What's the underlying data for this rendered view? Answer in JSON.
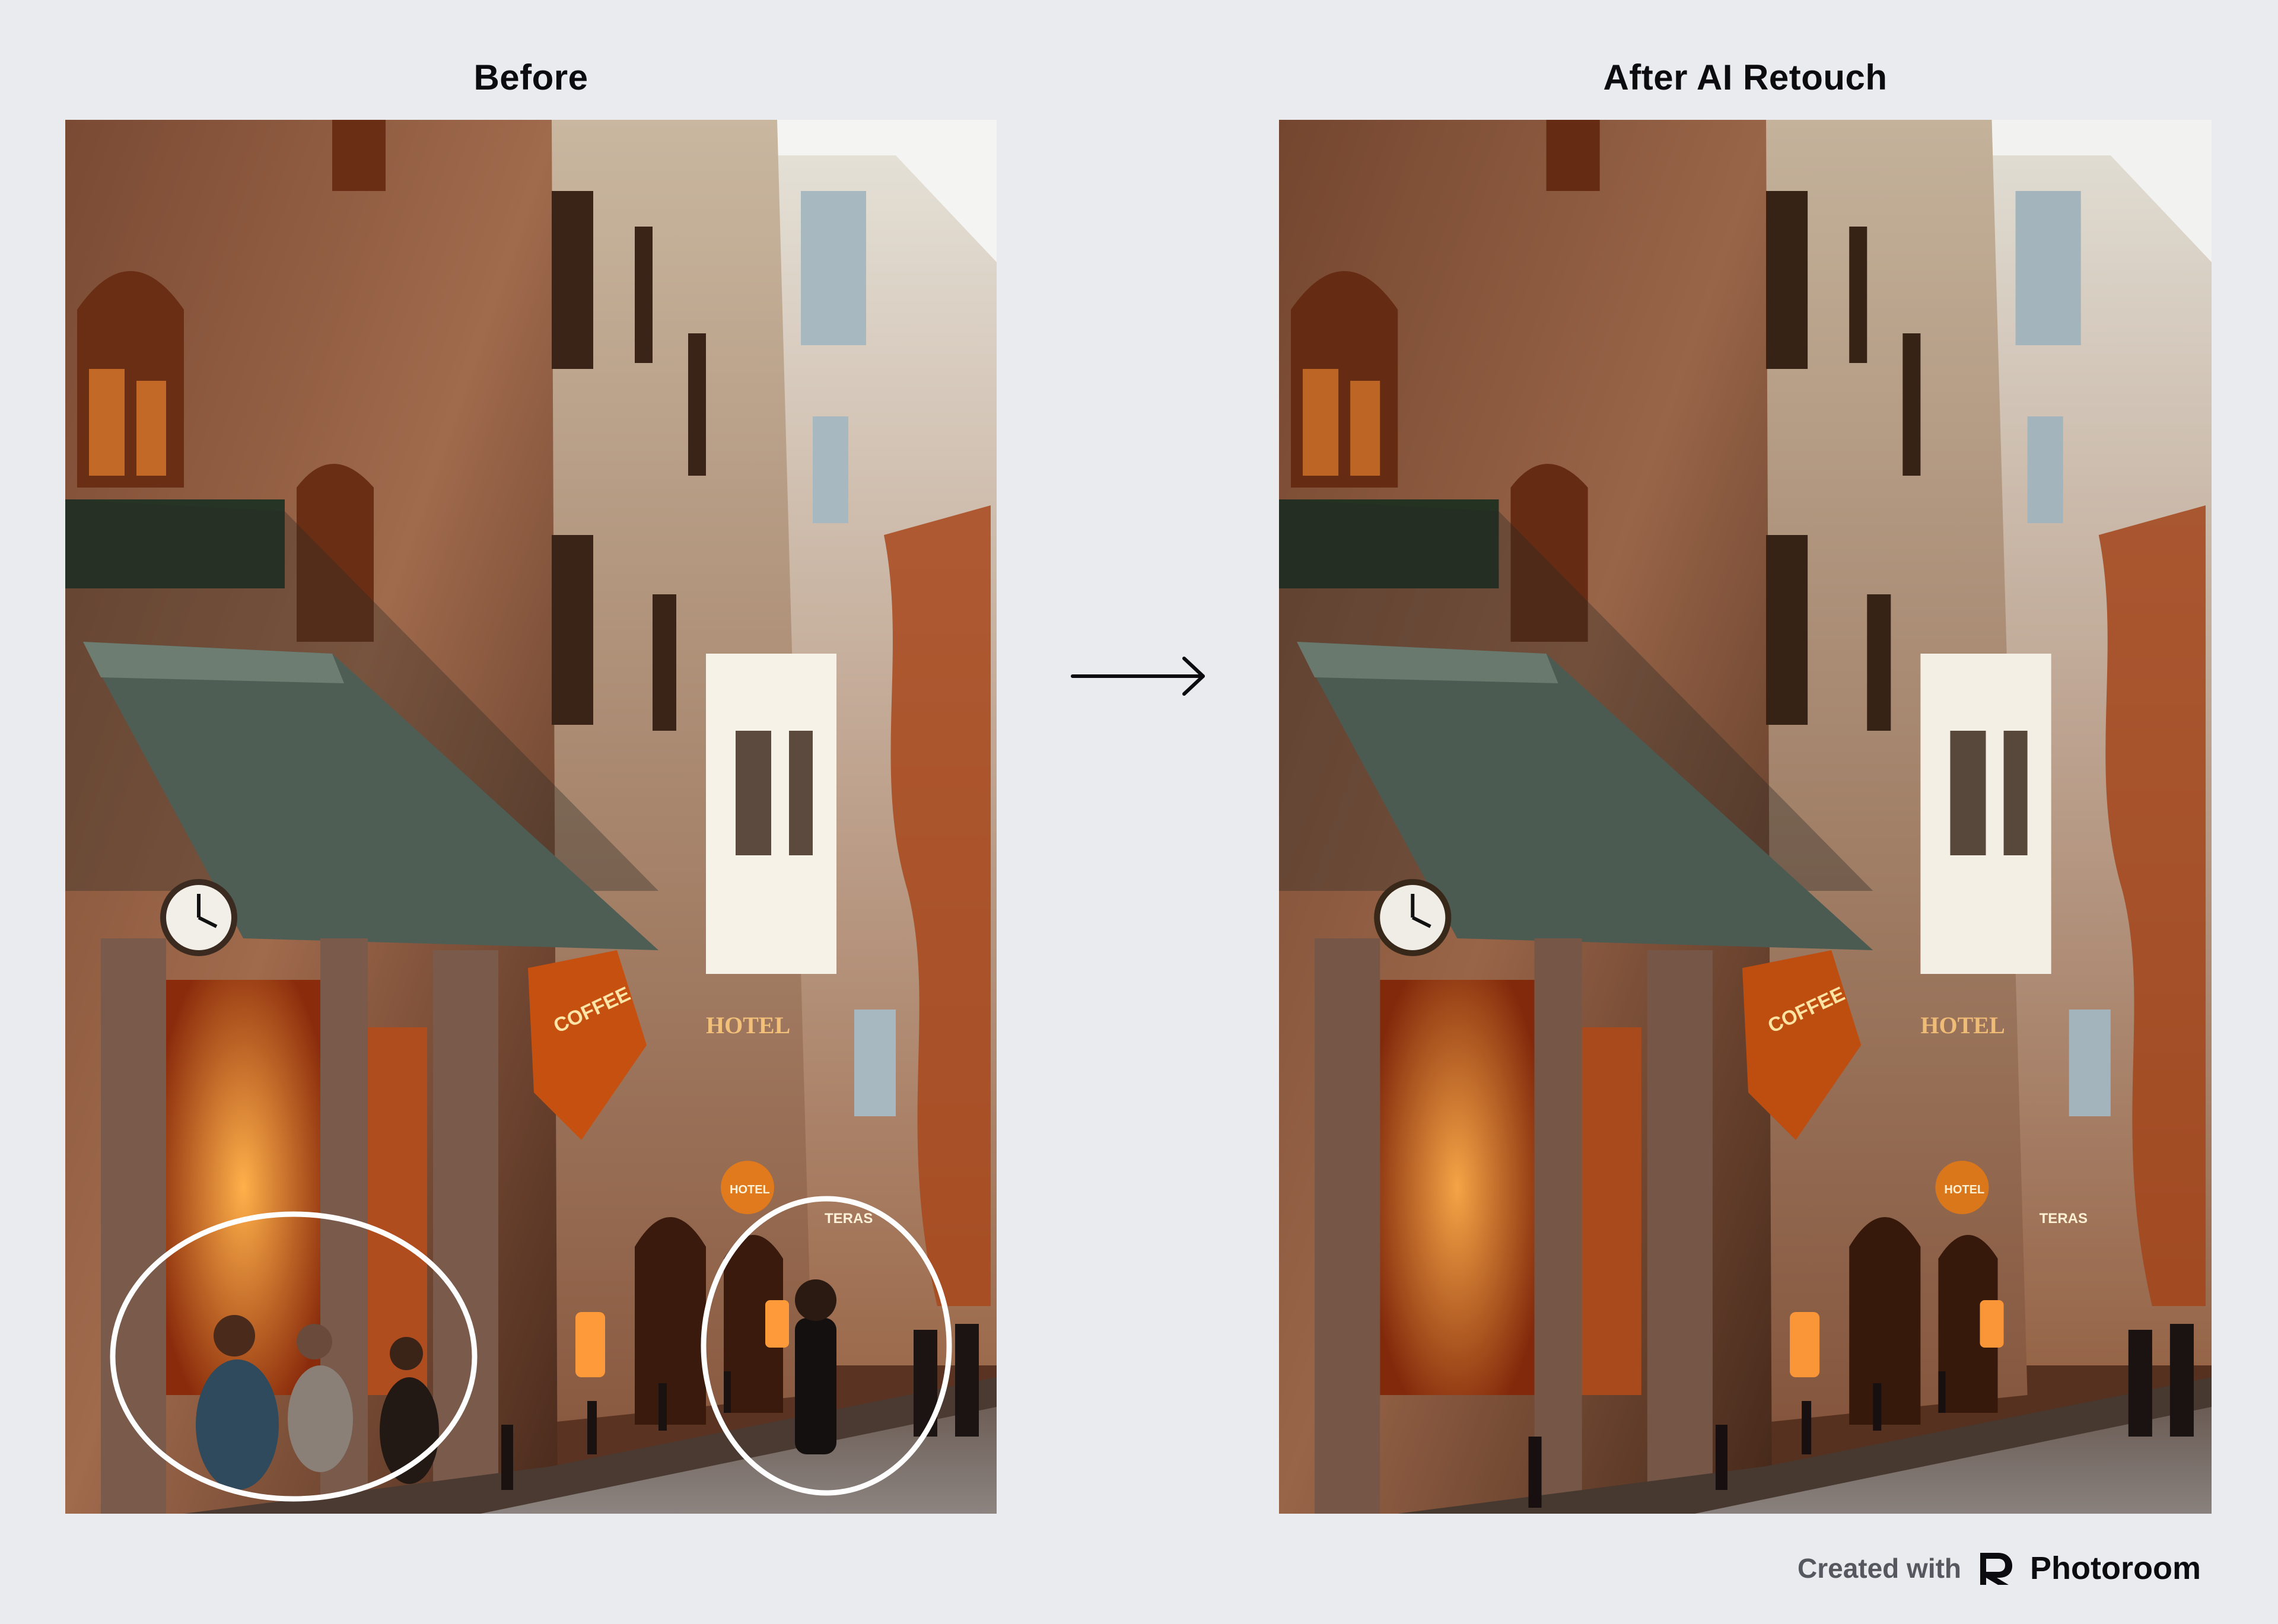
{
  "panels": {
    "before": {
      "title": "Before"
    },
    "after": {
      "title": "After AI Retouch"
    }
  },
  "photo": {
    "signs": {
      "coffee": "COFFEE",
      "hotel": "HOTEL",
      "teras": "TERAS",
      "hotel_round": "HOTEL"
    }
  },
  "footer": {
    "created_with": "Created with",
    "brand": "Photoroom"
  },
  "icons": {
    "arrow": "right-arrow-icon",
    "brand_logo": "photoroom-logo-icon"
  },
  "colors": {
    "background": "#e9ebef",
    "title": "#0c0c0e",
    "credit": "#55585e",
    "highlight_circle": "#ffffff"
  }
}
